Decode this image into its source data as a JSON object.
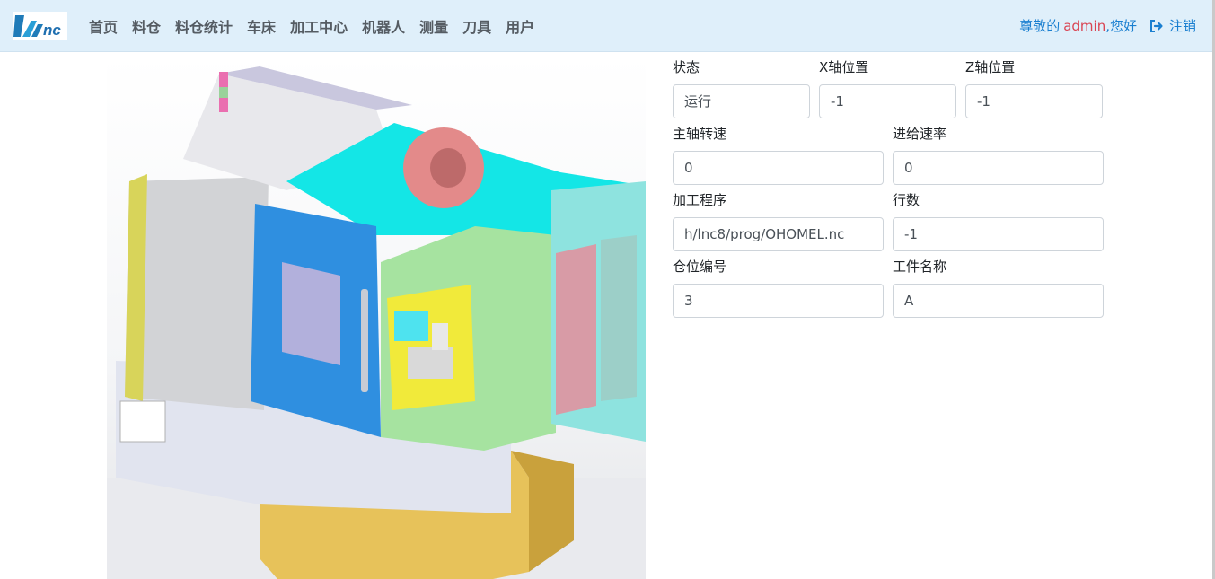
{
  "nav": {
    "logo_alt": "LNC",
    "items": [
      "首页",
      "料仓",
      "料仓统计",
      "车床",
      "加工中心",
      "机器人",
      "测量",
      "刀具",
      "用户"
    ]
  },
  "header": {
    "greeting_prefix": "尊敬的",
    "username": "admin",
    "greeting_suffix": ",您好",
    "logout_label": "注销"
  },
  "colors": {
    "navbar_bg": "#dfeffa",
    "link_blue": "#1a7fd0",
    "username_red": "#d94452"
  },
  "machine_image": {
    "alt": "CNC lathe machine 3D render"
  },
  "fields": {
    "status": {
      "label": "状态",
      "value": "运行"
    },
    "x_pos": {
      "label": "X轴位置",
      "value": "-1"
    },
    "z_pos": {
      "label": "Z轴位置",
      "value": "-1"
    },
    "spindle_speed": {
      "label": "主轴转速",
      "value": "0"
    },
    "feed_rate": {
      "label": "进给速率",
      "value": "0"
    },
    "program": {
      "label": "加工程序",
      "value": "h/lnc8/prog/OHOMEL.nc"
    },
    "line_no": {
      "label": "行数",
      "value": "-1"
    },
    "slot_no": {
      "label": "仓位编号",
      "value": "3"
    },
    "part_name": {
      "label": "工件名称",
      "value": "A"
    }
  }
}
